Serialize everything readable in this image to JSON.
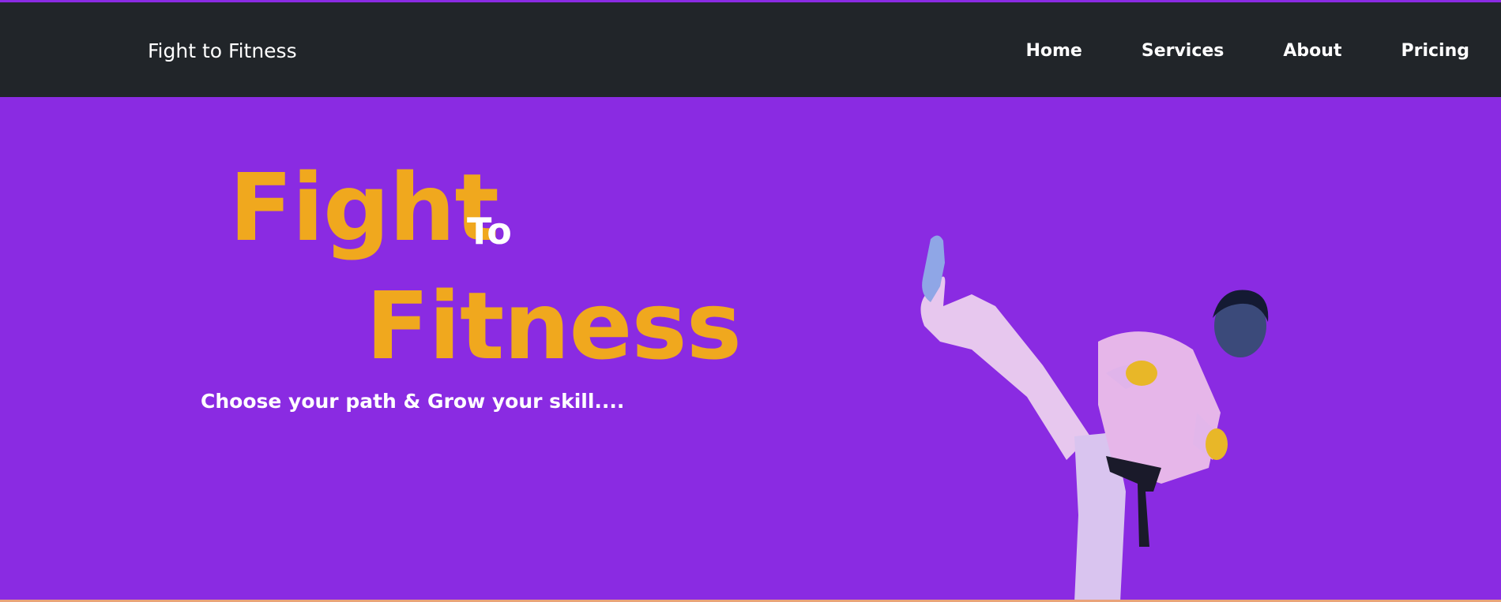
{
  "navbar": {
    "brand": "Fight to Fitness",
    "links": [
      {
        "label": "Home"
      },
      {
        "label": "Services"
      },
      {
        "label": "About"
      },
      {
        "label": "Pricing"
      }
    ]
  },
  "hero": {
    "title_fight": "Fight",
    "title_to": "To",
    "title_fitness": "Fitness",
    "tagline": "Choose your path & Grow your skill...."
  },
  "colors": {
    "navbar_bg": "#212529",
    "hero_bg": "#8a2be2",
    "accent": "#f0a81e",
    "text": "#ffffff"
  }
}
